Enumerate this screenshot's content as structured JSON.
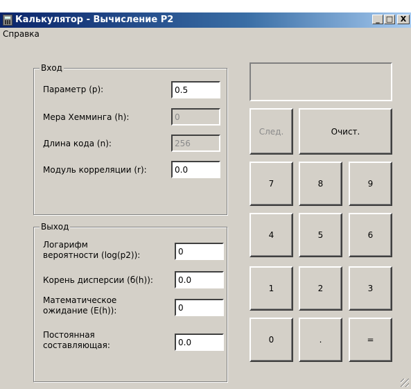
{
  "window": {
    "title": "Калькулятор - Вычисление Р2",
    "minimize": "_",
    "maximize": "□",
    "close": "X"
  },
  "menu": {
    "help": "Справка"
  },
  "input_group": {
    "title": "Вход",
    "param_label": "Параметр (p):",
    "param_value": "0.5",
    "hamming_label": "Мера Хемминга (h):",
    "hamming_value": "0",
    "code_len_label": "Длина кода (n):",
    "code_len_value": "256",
    "corr_label": "Модуль корреляции (r):",
    "corr_value": "0.0"
  },
  "output_group": {
    "title": "Выход",
    "log_label_1": "Логарифм",
    "log_label_2": "вероятности (log(p2)):",
    "log_value": "0",
    "sigma_label": "Корень дисперсии (б(h)):",
    "sigma_value": "0.0",
    "expect_label_1": "Математическое",
    "expect_label_2": "ожидание (E(h)):",
    "expect_value": "0",
    "const_label_1": "Постоянная",
    "const_label_2": "составляющая:",
    "const_value": "0.0"
  },
  "keypad": {
    "next": "След.",
    "clear": "Очист.",
    "k7": "7",
    "k8": "8",
    "k9": "9",
    "k4": "4",
    "k5": "5",
    "k6": "6",
    "k1": "1",
    "k2": "2",
    "k3": "3",
    "k0": "0",
    "dot": ".",
    "eq": "="
  },
  "display_value": ""
}
